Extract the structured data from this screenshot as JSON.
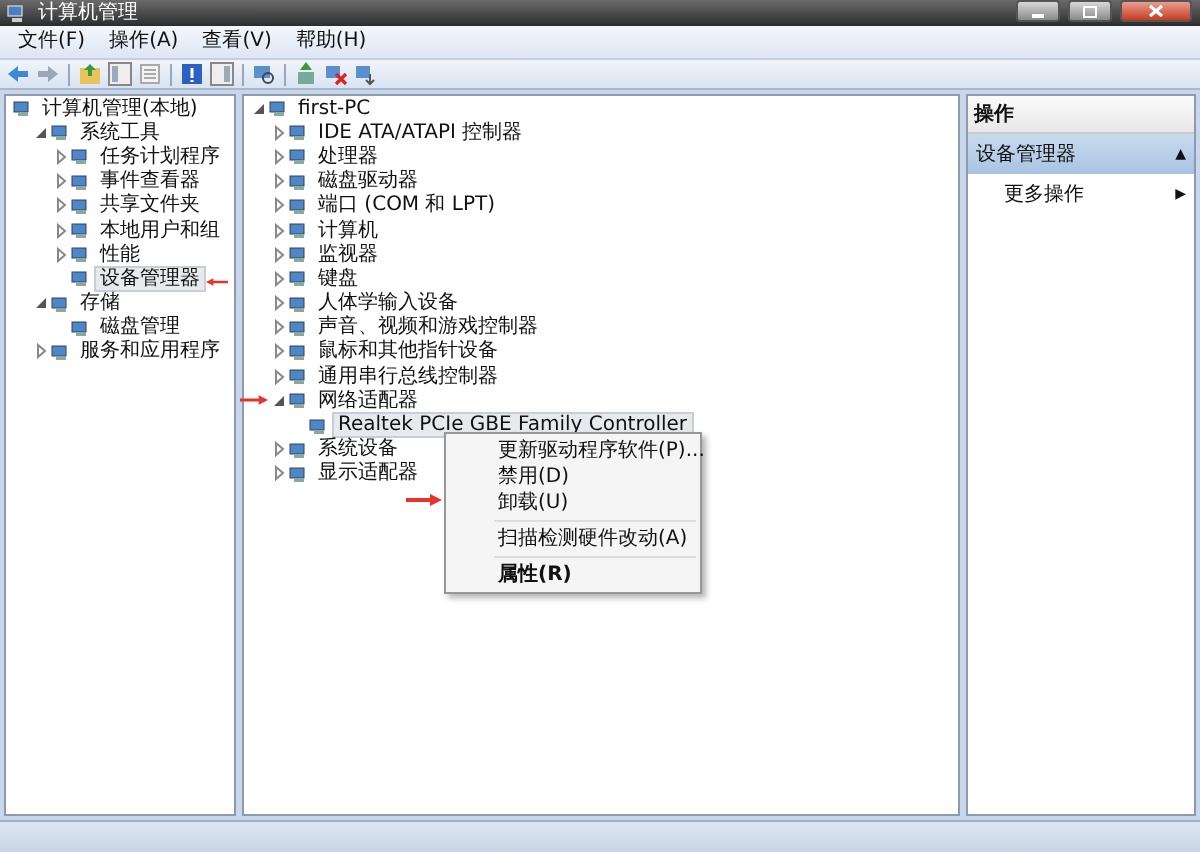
{
  "window": {
    "title": "计算机管理"
  },
  "menu_bar": [
    "文件(F)",
    "操作(A)",
    "查看(V)",
    "帮助(H)"
  ],
  "console_tree": {
    "items": [
      {
        "label": "计算机管理(本地)",
        "selected": false,
        "children": [
          {
            "label": "系统工具",
            "kind": "folder",
            "expanded": true,
            "selected": false,
            "children": [
              {
                "label": "任务计划程序",
                "kind": "folder",
                "expanded": false,
                "selected": false
              },
              {
                "label": "事件查看器",
                "kind": "folder",
                "expanded": false,
                "selected": false
              },
              {
                "label": "共享文件夹",
                "kind": "folder",
                "expanded": false,
                "selected": false
              },
              {
                "label": "本地用户和组",
                "kind": "folder",
                "expanded": false,
                "selected": false
              },
              {
                "label": "性能",
                "kind": "folder",
                "expanded": false,
                "selected": false
              },
              {
                "label": "设备管理器",
                "kind": "leaf",
                "selected": true
              }
            ]
          },
          {
            "label": "存储",
            "kind": "folder",
            "expanded": true,
            "selected": false,
            "children": [
              {
                "label": "磁盘管理",
                "kind": "leaf",
                "selected": false
              }
            ]
          },
          {
            "label": "服务和应用程序",
            "kind": "folder",
            "expanded": false,
            "selected": false
          }
        ]
      }
    ]
  },
  "device_tree": {
    "items": [
      {
        "label": "first-PC",
        "kind": "folder",
        "expanded": true,
        "selected": false,
        "children": [
          {
            "label": "IDE ATA/ATAPI 控制器",
            "kind": "folder",
            "expanded": false,
            "selected": false
          },
          {
            "label": "处理器",
            "kind": "folder",
            "expanded": false,
            "selected": false
          },
          {
            "label": "磁盘驱动器",
            "kind": "folder",
            "expanded": false,
            "selected": false
          },
          {
            "label": "端口 (COM 和 LPT)",
            "kind": "folder",
            "expanded": false,
            "selected": false
          },
          {
            "label": "计算机",
            "kind": "folder",
            "expanded": false,
            "selected": false
          },
          {
            "label": "监视器",
            "kind": "folder",
            "expanded": false,
            "selected": false
          },
          {
            "label": "键盘",
            "kind": "folder",
            "expanded": false,
            "selected": false
          },
          {
            "label": "人体学输入设备",
            "kind": "folder",
            "expanded": false,
            "selected": false
          },
          {
            "label": "声音、视频和游戏控制器",
            "kind": "folder",
            "expanded": false,
            "selected": false
          },
          {
            "label": "鼠标和其他指针设备",
            "kind": "folder",
            "expanded": false,
            "selected": false
          },
          {
            "label": "通用串行总线控制器",
            "kind": "folder",
            "expanded": false,
            "selected": false
          },
          {
            "label": "网络适配器",
            "kind": "folder",
            "expanded": true,
            "selected": false,
            "children": [
              {
                "label": "Realtek PCIe GBE Family Controller",
                "kind": "leaf",
                "selected": true
              }
            ]
          },
          {
            "label": "系统设备",
            "kind": "folder",
            "expanded": false,
            "selected": false
          },
          {
            "label": "显示适配器",
            "kind": "folder",
            "expanded": false,
            "selected": false
          }
        ]
      }
    ]
  },
  "context_menu": [
    {
      "kind": "item",
      "label": "更新驱动程序软件(P)...",
      "default": false
    },
    {
      "kind": "item",
      "label": "禁用(D)",
      "default": false
    },
    {
      "kind": "item",
      "label": "卸载(U)",
      "default": false
    },
    {
      "kind": "separator"
    },
    {
      "kind": "item",
      "label": "扫描检测硬件改动(A)",
      "default": false
    },
    {
      "kind": "separator"
    },
    {
      "kind": "item",
      "label": "属性(R)",
      "default": true
    }
  ],
  "actions": {
    "title": "操作",
    "section": {
      "label": "设备管理器",
      "glyph": "▲"
    },
    "items": [
      {
        "label": "更多操作",
        "glyph": "▶"
      }
    ]
  }
}
